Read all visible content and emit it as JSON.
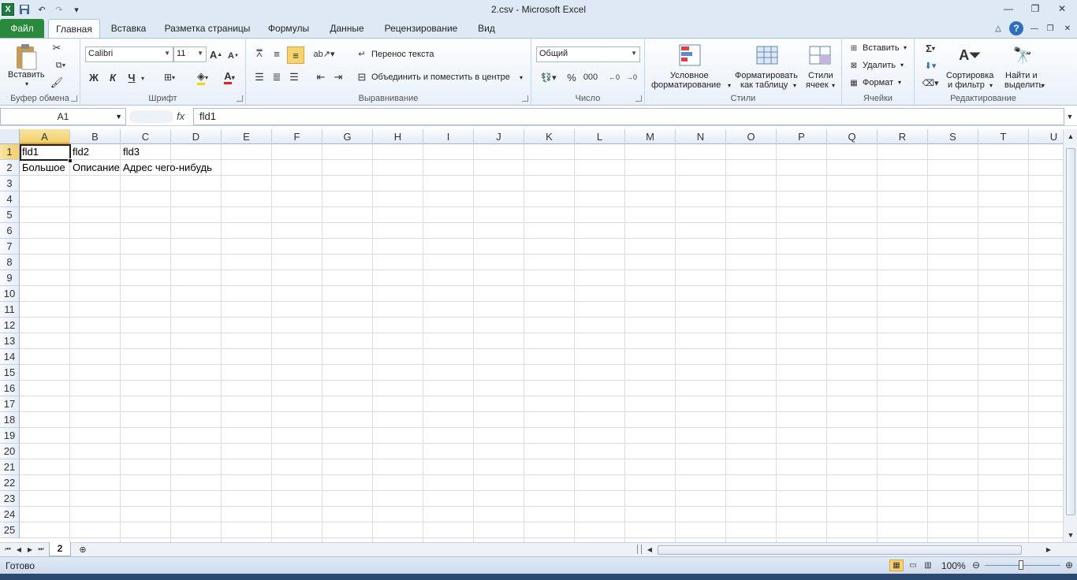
{
  "window": {
    "title": "2.csv  -  Microsoft Excel",
    "app_icon": "excel-icon",
    "qat": [
      "save-icon",
      "undo-icon",
      "redo-icon",
      "customize-icon"
    ],
    "controls": [
      "minimize-icon",
      "restore-icon",
      "close-icon"
    ]
  },
  "tabs": [
    {
      "label": "Файл",
      "kind": "file"
    },
    {
      "label": "Главная",
      "kind": "active"
    },
    {
      "label": "Вставка"
    },
    {
      "label": "Разметка страницы"
    },
    {
      "label": "Формулы"
    },
    {
      "label": "Данные"
    },
    {
      "label": "Рецензирование"
    },
    {
      "label": "Вид"
    }
  ],
  "ribbon": {
    "clipboard": {
      "label": "Буфер обмена",
      "paste": "Вставить"
    },
    "font": {
      "label": "Шрифт",
      "name": "Calibri",
      "size": "11",
      "bold": "Ж",
      "italic": "К",
      "underline": "Ч"
    },
    "alignment": {
      "label": "Выравнивание",
      "wrap": "Перенос текста",
      "merge": "Объединить и поместить в центре"
    },
    "number": {
      "label": "Число",
      "format": "Общий",
      "percent": "%",
      "thousands": "000"
    },
    "styles": {
      "label": "Стили",
      "conditional_1": "Условное",
      "conditional_2": "форматирование",
      "table_1": "Форматировать",
      "table_2": "как таблицу",
      "cell_1": "Стили",
      "cell_2": "ячеек"
    },
    "cells": {
      "label": "Ячейки",
      "insert": "Вставить",
      "delete": "Удалить",
      "format": "Формат"
    },
    "editing": {
      "label": "Редактирование",
      "sort_1": "Сортировка",
      "sort_2": "и фильтр",
      "find_1": "Найти и",
      "find_2": "выделить",
      "sum": "Σ"
    }
  },
  "formula_bar": {
    "name_box": "A1",
    "fx": "fx",
    "content": "fld1"
  },
  "columns": [
    "A",
    "B",
    "C",
    "D",
    "E",
    "F",
    "G",
    "H",
    "I",
    "J",
    "K",
    "L",
    "M",
    "N",
    "O",
    "P",
    "Q",
    "R",
    "S",
    "T",
    "U"
  ],
  "rows": [
    "1",
    "2",
    "3",
    "4",
    "5",
    "6",
    "7",
    "8",
    "9",
    "10",
    "11",
    "12",
    "13",
    "14",
    "15",
    "16",
    "17",
    "18",
    "19",
    "20",
    "21",
    "22",
    "23",
    "24",
    "25"
  ],
  "cells": {
    "A1": "fld1",
    "B1": "fld2",
    "C1": "fld3",
    "A2": "Большое",
    "B2": "Описание",
    "C2": "Адрес чего-нибудь"
  },
  "sheet_tab": "2",
  "status": {
    "ready": "Готово",
    "zoom": "100%"
  },
  "colors": {
    "accent": "#2a8a3c",
    "ribbon_bg": "#dfe9f5",
    "selected_header": "#f3cf6a"
  }
}
